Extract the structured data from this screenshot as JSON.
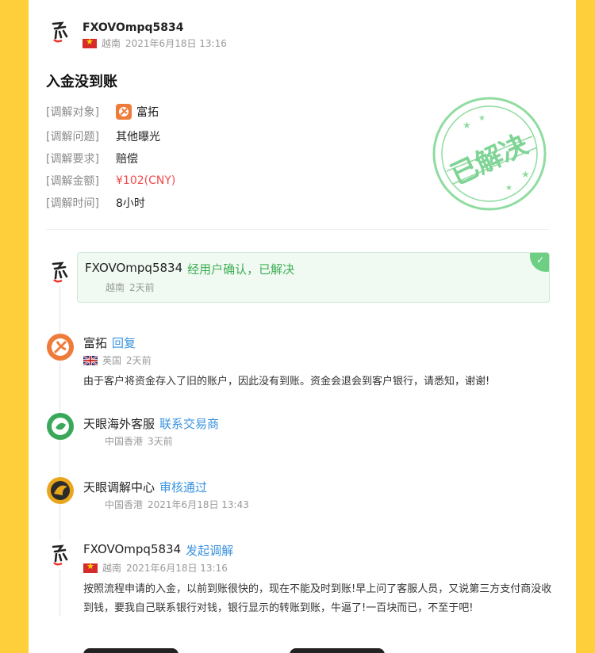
{
  "header": {
    "username": "FXOVOmpq5834",
    "country": "越南",
    "time": "2021年6月18日 13:16"
  },
  "complaint": {
    "title": "入金没到账",
    "rows": [
      {
        "label": "[调解对象]",
        "value": "富拓"
      },
      {
        "label": "[调解问题]",
        "value": "其他曝光"
      },
      {
        "label": "[调解要求]",
        "value": "赔偿"
      },
      {
        "label": "[调解金额]",
        "value": "¥102(CNY)"
      },
      {
        "label": "[调解时间]",
        "value": "8小时"
      }
    ],
    "stamp": "已解决"
  },
  "timeline": [
    {
      "name": "FXOVOmpq5834",
      "action": "经用户确认，已解决",
      "country": "越南",
      "time": "2天前"
    },
    {
      "name": "富拓",
      "action": "回复",
      "country": "英国",
      "time": "2天前",
      "body": "由于客户将资金存入了旧的账户，因此没有到账。资金会退会到客户银行，请悉知，谢谢!"
    },
    {
      "name": "天眼海外客服",
      "action": "联系交易商",
      "country": "中国香港",
      "time": "3天前"
    },
    {
      "name": "天眼调解中心",
      "action": "审核通过",
      "country": "中国香港",
      "time": "2021年6月18日 13:43"
    },
    {
      "name": "FXOVOmpq5834",
      "action": "发起调解",
      "country": "越南",
      "time": "2021年6月18日 13:16",
      "body": "按照流程申请的入金，以前到账很快的，现在不能及时到账!早上问了客服人员，又说第三方支付商没收到钱，要我自己联系银行对钱，银行显示的转账到账，牛逼了!一百块而已，不至于吧!"
    }
  ],
  "colors": {
    "background": "#fecf3a",
    "link": "#3a93e0",
    "resolved": "#3fae55",
    "amount": "#f04a4a",
    "stamp": "#6ccf82"
  }
}
